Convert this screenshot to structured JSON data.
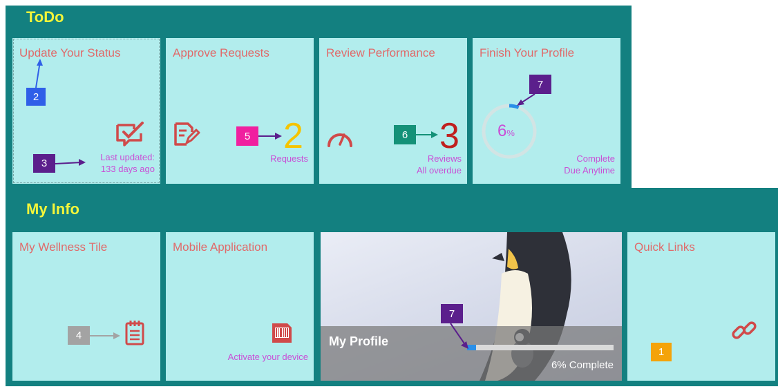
{
  "todo": {
    "heading": "ToDo",
    "tiles": [
      {
        "title": "Update Your Status",
        "sub1": "Last updated:",
        "sub2": "133 days ago"
      },
      {
        "title": "Approve Requests",
        "count": "2",
        "sub1": "Requests"
      },
      {
        "title": "Review Performance",
        "count": "3",
        "sub1": "Reviews",
        "sub2": "All overdue"
      },
      {
        "title": "Finish Your Profile",
        "percent_value": "6",
        "percent_sign": "%",
        "progress": 0.06,
        "sub1": "Complete",
        "sub2": "Due Anytime"
      }
    ]
  },
  "myinfo": {
    "heading": "My Info",
    "tiles": [
      {
        "title": "My Wellness Tile"
      },
      {
        "title": "Mobile Application",
        "sub1": "Activate your device"
      },
      {
        "title": "My Profile",
        "progress": 0.06,
        "progress_label": "6% Complete"
      },
      {
        "title": "Quick Links"
      }
    ]
  },
  "badges": {
    "b1": "1",
    "b2": "2",
    "b3": "3",
    "b4": "4",
    "b5": "5",
    "b6": "6",
    "b7a": "7",
    "b7b": "7"
  },
  "colors": {
    "teal_bg": "#138080",
    "tile_bg": "#b2eded",
    "heading": "#f3f53a",
    "title": "#e06a6a",
    "accent_pink": "#c94fd6",
    "count_yellow": "#f5c400",
    "count_red": "#c0201f",
    "progress_blue": "#2a8fe8",
    "badge_blue": "#2f5fe8",
    "badge_purple": "#5b1f8c",
    "badge_magenta": "#f0209f",
    "badge_green": "#149178",
    "badge_gray": "#a3a3a3",
    "badge_orange": "#f4a30a"
  },
  "icons": {
    "status": "checkmark-speech-icon",
    "approve": "document-pencil-icon",
    "review": "speedometer-icon",
    "wellness": "notepad-icon",
    "mobile": "barcode-icon",
    "links": "chain-link-icon"
  }
}
